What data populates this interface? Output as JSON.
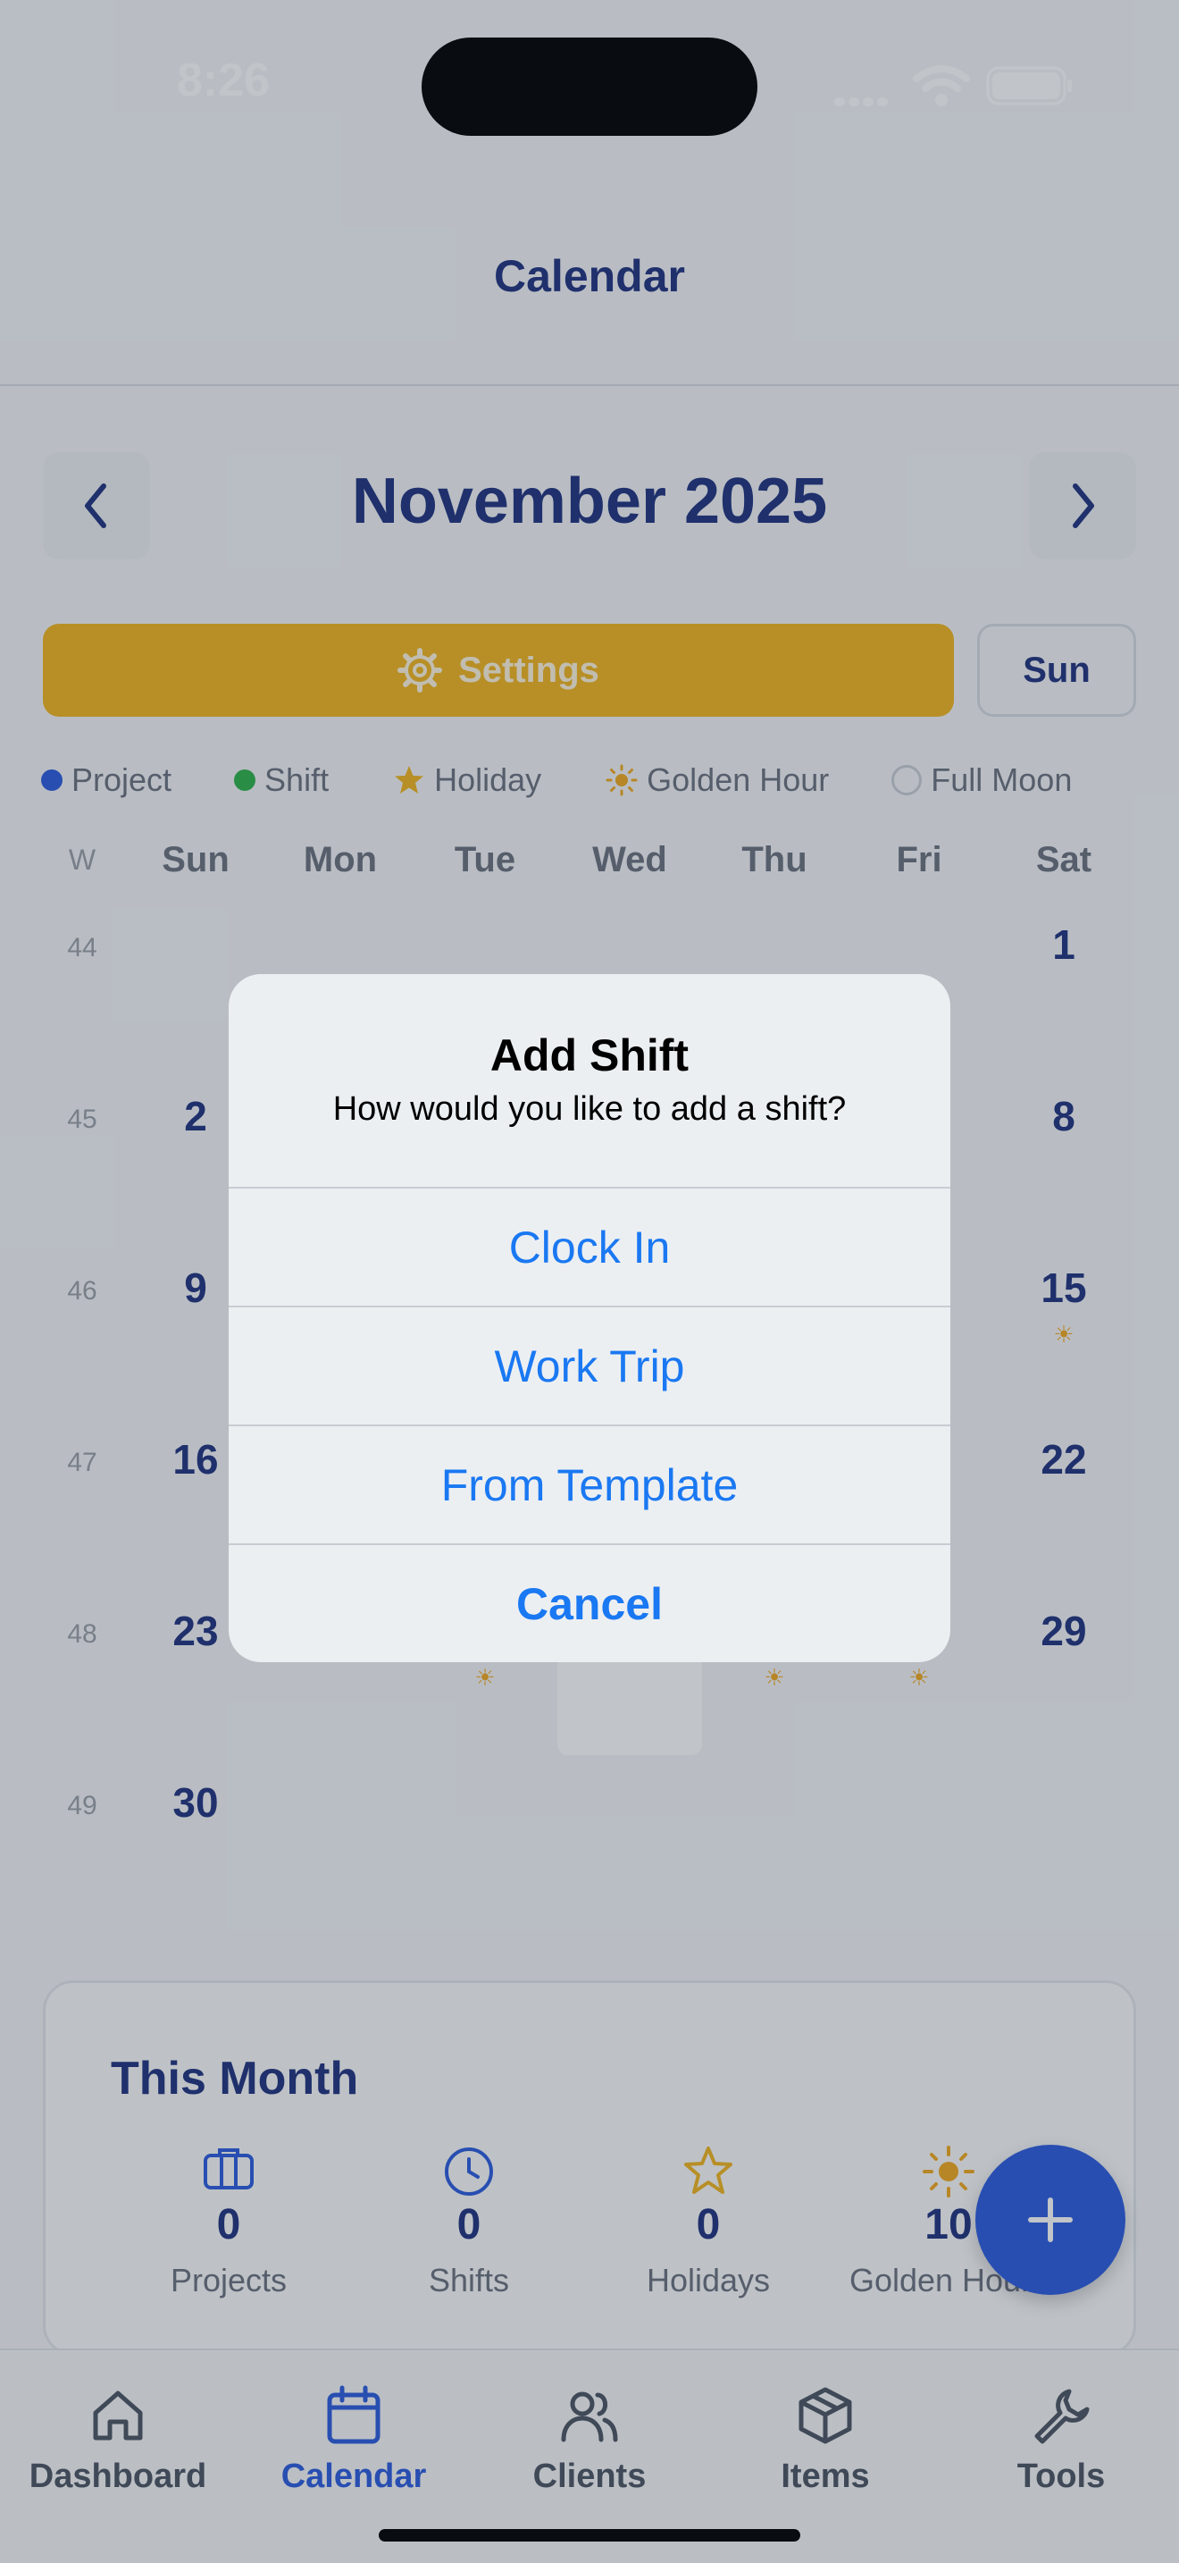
{
  "status_bar": {
    "time": "8:26"
  },
  "header": {
    "title": "Calendar"
  },
  "month_nav": {
    "title": "November 2025",
    "prev_icon": "chevron-left-icon",
    "next_icon": "chevron-right-icon"
  },
  "controls": {
    "settings_label": "Settings",
    "week_start_label": "Sun"
  },
  "legend": [
    {
      "label": "Project",
      "color": "#2c5ce0"
    },
    {
      "label": "Shift",
      "color": "#2fb34a"
    },
    {
      "label": "Holiday",
      "color": "#f2b61f"
    },
    {
      "label": "Golden Hour",
      "color": "#f2a91f"
    },
    {
      "label": "Full Moon",
      "color": "#c9ced6"
    }
  ],
  "calendar": {
    "week_col_header": "W",
    "day_headers": [
      "Sun",
      "Mon",
      "Tue",
      "Wed",
      "Thu",
      "Fri",
      "Sat"
    ],
    "weeks": [
      {
        "num": "44",
        "days": [
          "",
          "",
          "",
          "",
          "",
          "",
          "1"
        ]
      },
      {
        "num": "45",
        "days": [
          "2",
          "",
          "",
          "",
          "",
          "",
          "8"
        ]
      },
      {
        "num": "46",
        "days": [
          "9",
          "",
          "",
          "",
          "",
          "",
          "15"
        ]
      },
      {
        "num": "47",
        "days": [
          "16",
          "",
          "",
          "",
          "",
          "",
          "22"
        ]
      },
      {
        "num": "48",
        "days": [
          "23",
          "",
          "",
          "",
          "",
          "",
          "29"
        ]
      },
      {
        "num": "49",
        "days": [
          "30",
          "",
          "",
          "",
          "",
          "",
          ""
        ]
      }
    ]
  },
  "this_month": {
    "title": "This Month",
    "stats": [
      {
        "value": "0",
        "label": "Projects",
        "icon": "briefcase-icon"
      },
      {
        "value": "0",
        "label": "Shifts",
        "icon": "clock-icon"
      },
      {
        "value": "0",
        "label": "Holidays",
        "icon": "star-icon"
      },
      {
        "value": "10",
        "label": "Golden Hours",
        "icon": "sun-icon"
      }
    ]
  },
  "alert": {
    "title": "Add Shift",
    "message": "How would you like to add a shift?",
    "actions": [
      "Clock In",
      "Work Trip",
      "From Template",
      "Cancel"
    ]
  },
  "tab_bar": {
    "tabs": [
      {
        "label": "Dashboard",
        "icon": "home-icon"
      },
      {
        "label": "Calendar",
        "icon": "calendar-icon"
      },
      {
        "label": "Clients",
        "icon": "users-icon"
      },
      {
        "label": "Items",
        "icon": "box-icon"
      },
      {
        "label": "Tools",
        "icon": "wrench-icon"
      }
    ],
    "active": "Calendar"
  }
}
